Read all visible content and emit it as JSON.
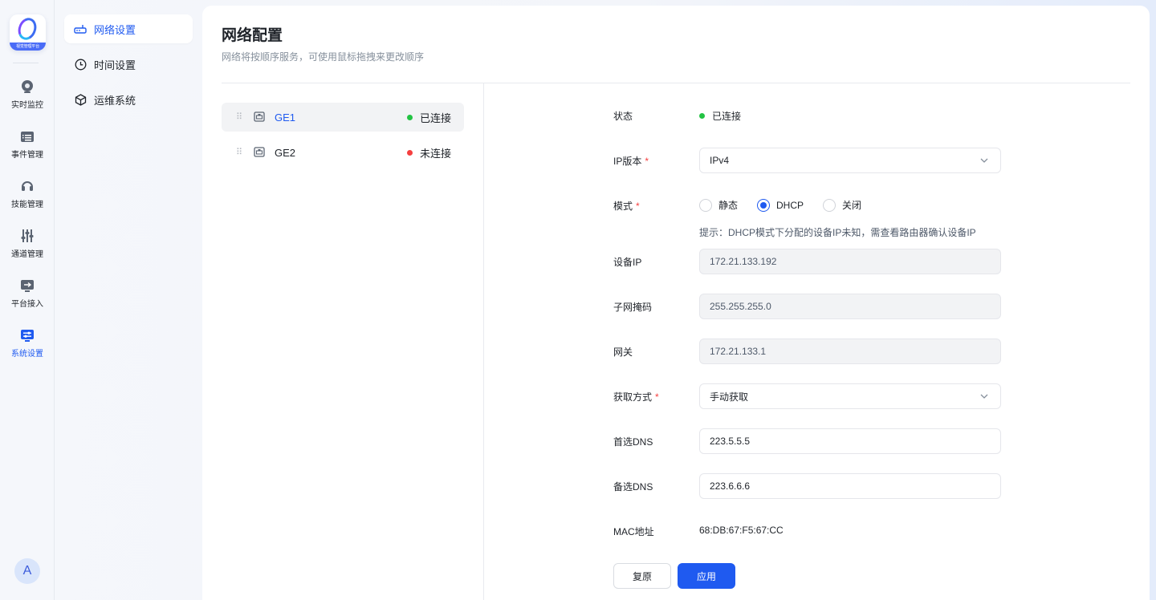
{
  "app": {
    "logo_caption": "视觉管理平台"
  },
  "rail": {
    "items": [
      {
        "label": "实时监控",
        "icon": "camera-icon"
      },
      {
        "label": "事件管理",
        "icon": "folder-list-icon"
      },
      {
        "label": "技能管理",
        "icon": "headset-icon"
      },
      {
        "label": "通道管理",
        "icon": "sliders-icon"
      },
      {
        "label": "平台接入",
        "icon": "login-arrow-icon"
      },
      {
        "label": "系统设置",
        "icon": "settings-panel-icon"
      }
    ],
    "active": "系统设置",
    "avatar": "A"
  },
  "submenu": {
    "items": [
      {
        "label": "网络设置",
        "icon": "router-icon"
      },
      {
        "label": "时间设置",
        "icon": "clock-icon"
      },
      {
        "label": "运维系统",
        "icon": "cube-icon"
      }
    ],
    "active": "网络设置"
  },
  "page": {
    "title": "网络配置",
    "subtitle": "网络将按顺序服务，可使用鼠标拖拽来更改顺序"
  },
  "interfaces": [
    {
      "name": "GE1",
      "status": "已连接",
      "status_color": "#23c343",
      "selected": true
    },
    {
      "name": "GE2",
      "status": "未连接",
      "status_color": "#f53f3f",
      "selected": false
    }
  ],
  "form": {
    "status": {
      "label": "状态",
      "value": "已连接",
      "color": "#23c343"
    },
    "ip_version": {
      "label": "IP版本",
      "value": "IPv4"
    },
    "mode": {
      "label": "模式",
      "options": [
        "静态",
        "DHCP",
        "关闭"
      ],
      "selected": "DHCP",
      "hint": "提示：DHCP模式下分配的设备IP未知，需查看路由器确认设备IP"
    },
    "device_ip": {
      "label": "设备IP",
      "value": "172.21.133.192"
    },
    "subnet_mask": {
      "label": "子网掩码",
      "value": "255.255.255.0"
    },
    "gateway": {
      "label": "网关",
      "value": "172.21.133.1"
    },
    "acquire": {
      "label": "获取方式",
      "value": "手动获取"
    },
    "dns1": {
      "label": "首选DNS",
      "value": "223.5.5.5"
    },
    "dns2": {
      "label": "备选DNS",
      "value": "223.6.6.6"
    },
    "mac": {
      "label": "MAC地址",
      "value": "68:DB:67:F5:67:CC"
    },
    "required_mark": "*"
  },
  "buttons": {
    "reset": "复原",
    "apply": "应用"
  },
  "colors": {
    "accent": "#1f5af0",
    "required": "#f53f3f"
  }
}
